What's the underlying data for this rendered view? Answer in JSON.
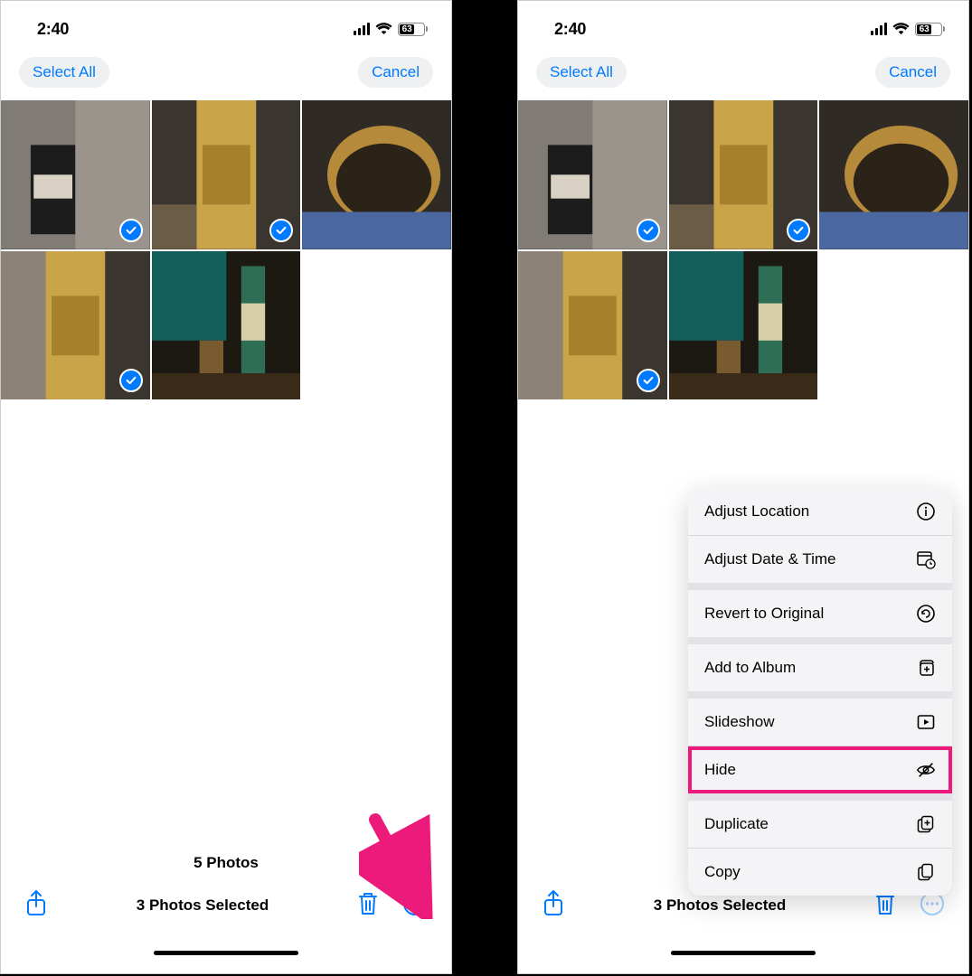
{
  "status": {
    "time": "2:40",
    "battery": "63"
  },
  "nav": {
    "select_all": "Select All",
    "cancel": "Cancel"
  },
  "left": {
    "count_label": "5 Photos",
    "selected_label": "3 Photos Selected",
    "thumbs": [
      {
        "selected": true
      },
      {
        "selected": true
      },
      {
        "selected": false
      },
      {
        "selected": true
      },
      {
        "selected": false
      }
    ]
  },
  "right": {
    "selected_label": "3 Photos Selected",
    "thumbs": [
      {
        "selected": true
      },
      {
        "selected": true
      },
      {
        "selected": false
      },
      {
        "selected": true
      },
      {
        "selected": false
      }
    ]
  },
  "menu": {
    "adjust_location": "Adjust Location",
    "adjust_datetime": "Adjust Date & Time",
    "revert": "Revert to Original",
    "add_album": "Add to Album",
    "slideshow": "Slideshow",
    "hide": "Hide",
    "duplicate": "Duplicate",
    "copy": "Copy"
  }
}
